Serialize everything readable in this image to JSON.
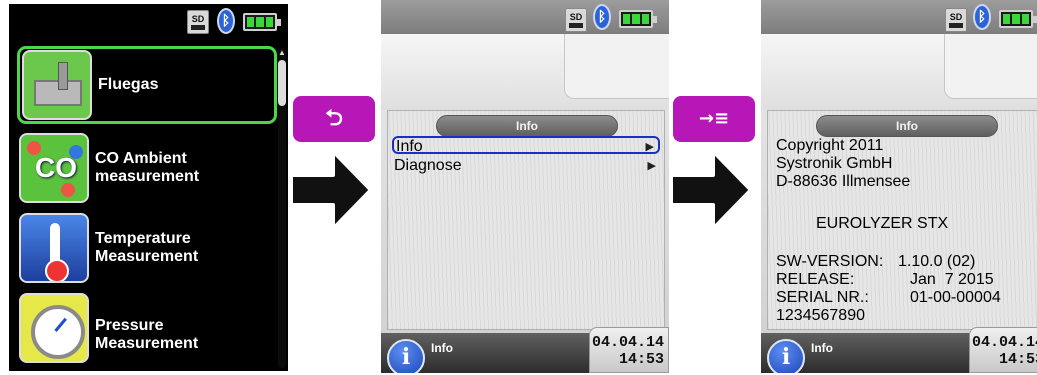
{
  "screen1": {
    "status": {
      "sd_label": "SD",
      "sd_icon": "sd-card-icon",
      "bluetooth_icon": "bluetooth-icon",
      "battery_icon": "battery-icon"
    },
    "menu_items": [
      {
        "label": "Fluegas",
        "icon": "factory-chimney-icon",
        "selected": true
      },
      {
        "label": "CO Ambient\nmeasurement",
        "icon": "co-molecule-icon",
        "icon_text": "CO"
      },
      {
        "label": "Temperature\nMeasurement",
        "icon": "thermometer-icon"
      },
      {
        "label": "Pressure\nMeasurement",
        "icon": "pressure-gauge-icon"
      }
    ],
    "scroll_position": 0.1
  },
  "softkeys": {
    "back_symbol": "⮌",
    "forward_symbol": "→≡"
  },
  "screen2": {
    "title": "Info",
    "items": [
      {
        "label": "Info",
        "arrow": "▶",
        "selected": true
      },
      {
        "label": "Diagnose",
        "arrow": "▶"
      }
    ],
    "bottom_label": "Info",
    "info_glyph": "i",
    "date": "04.04.14",
    "time": "14:53"
  },
  "screen3": {
    "title": "Info",
    "lines": {
      "copyright": "Copyright 2011",
      "company": "Systronik GmbH",
      "address": "D-88636 Illmensee",
      "product": "EUROLYZER STX",
      "sw_version_label": "SW-VERSION:",
      "sw_version_value": "1.10.0 (02)",
      "release_label": "RELEASE:",
      "release_value": "Jan  7 2015",
      "serial_label": "SERIAL NR.:",
      "serial_value": "01-00-00004",
      "serial_extra": "1234567890"
    },
    "bottom_label": "Info",
    "info_glyph": "i",
    "date": "04.04.14",
    "time": "14:53"
  },
  "colors": {
    "accent_green": "#4cd64c",
    "softkey_magenta": "#b717b7",
    "selection_blue": "#1d2fc3"
  }
}
